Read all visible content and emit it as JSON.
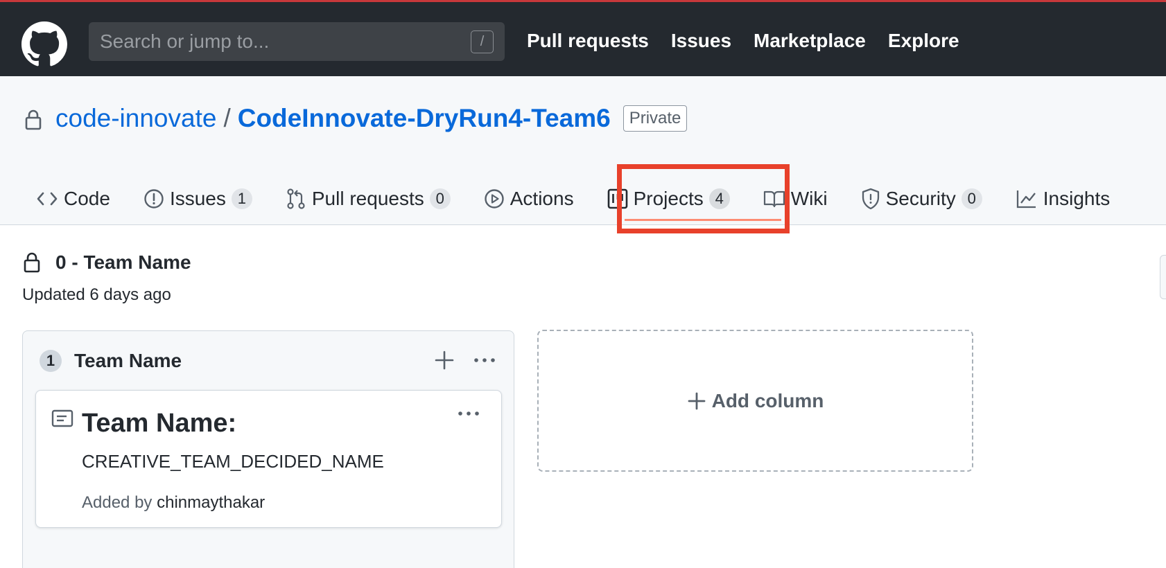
{
  "header": {
    "search_placeholder": "Search or jump to...",
    "search_shortcut": "/",
    "nav": [
      "Pull requests",
      "Issues",
      "Marketplace",
      "Explore"
    ],
    "bg_color": "#24292f"
  },
  "repo": {
    "owner": "code-innovate",
    "separator": "/",
    "name": "CodeInnovate-DryRun4-Team6",
    "visibility": "Private",
    "tabs": [
      {
        "label": "Code",
        "icon": "code-icon"
      },
      {
        "label": "Issues",
        "count": "1",
        "icon": "issue-opened-icon"
      },
      {
        "label": "Pull requests",
        "count": "0",
        "icon": "git-pull-request-icon"
      },
      {
        "label": "Actions",
        "icon": "play-icon"
      },
      {
        "label": "Projects",
        "count": "4",
        "icon": "project-icon",
        "selected": true
      },
      {
        "label": "Wiki",
        "icon": "book-icon"
      },
      {
        "label": "Security",
        "count": "0",
        "icon": "shield-icon"
      },
      {
        "label": "Insights",
        "icon": "graph-icon"
      }
    ],
    "highlight_color": "#e8412b"
  },
  "project": {
    "title": "0 - Team Name",
    "updated": "Updated 6 days ago",
    "columns": [
      {
        "count": "1",
        "name": "Team Name",
        "cards": [
          {
            "heading": "Team Name:",
            "body": "CREATIVE_TEAM_DECIDED_NAME",
            "added_by_label": "Added by",
            "added_by_user": "chinmaythakar"
          }
        ]
      }
    ],
    "add_column_label": "Add column"
  }
}
